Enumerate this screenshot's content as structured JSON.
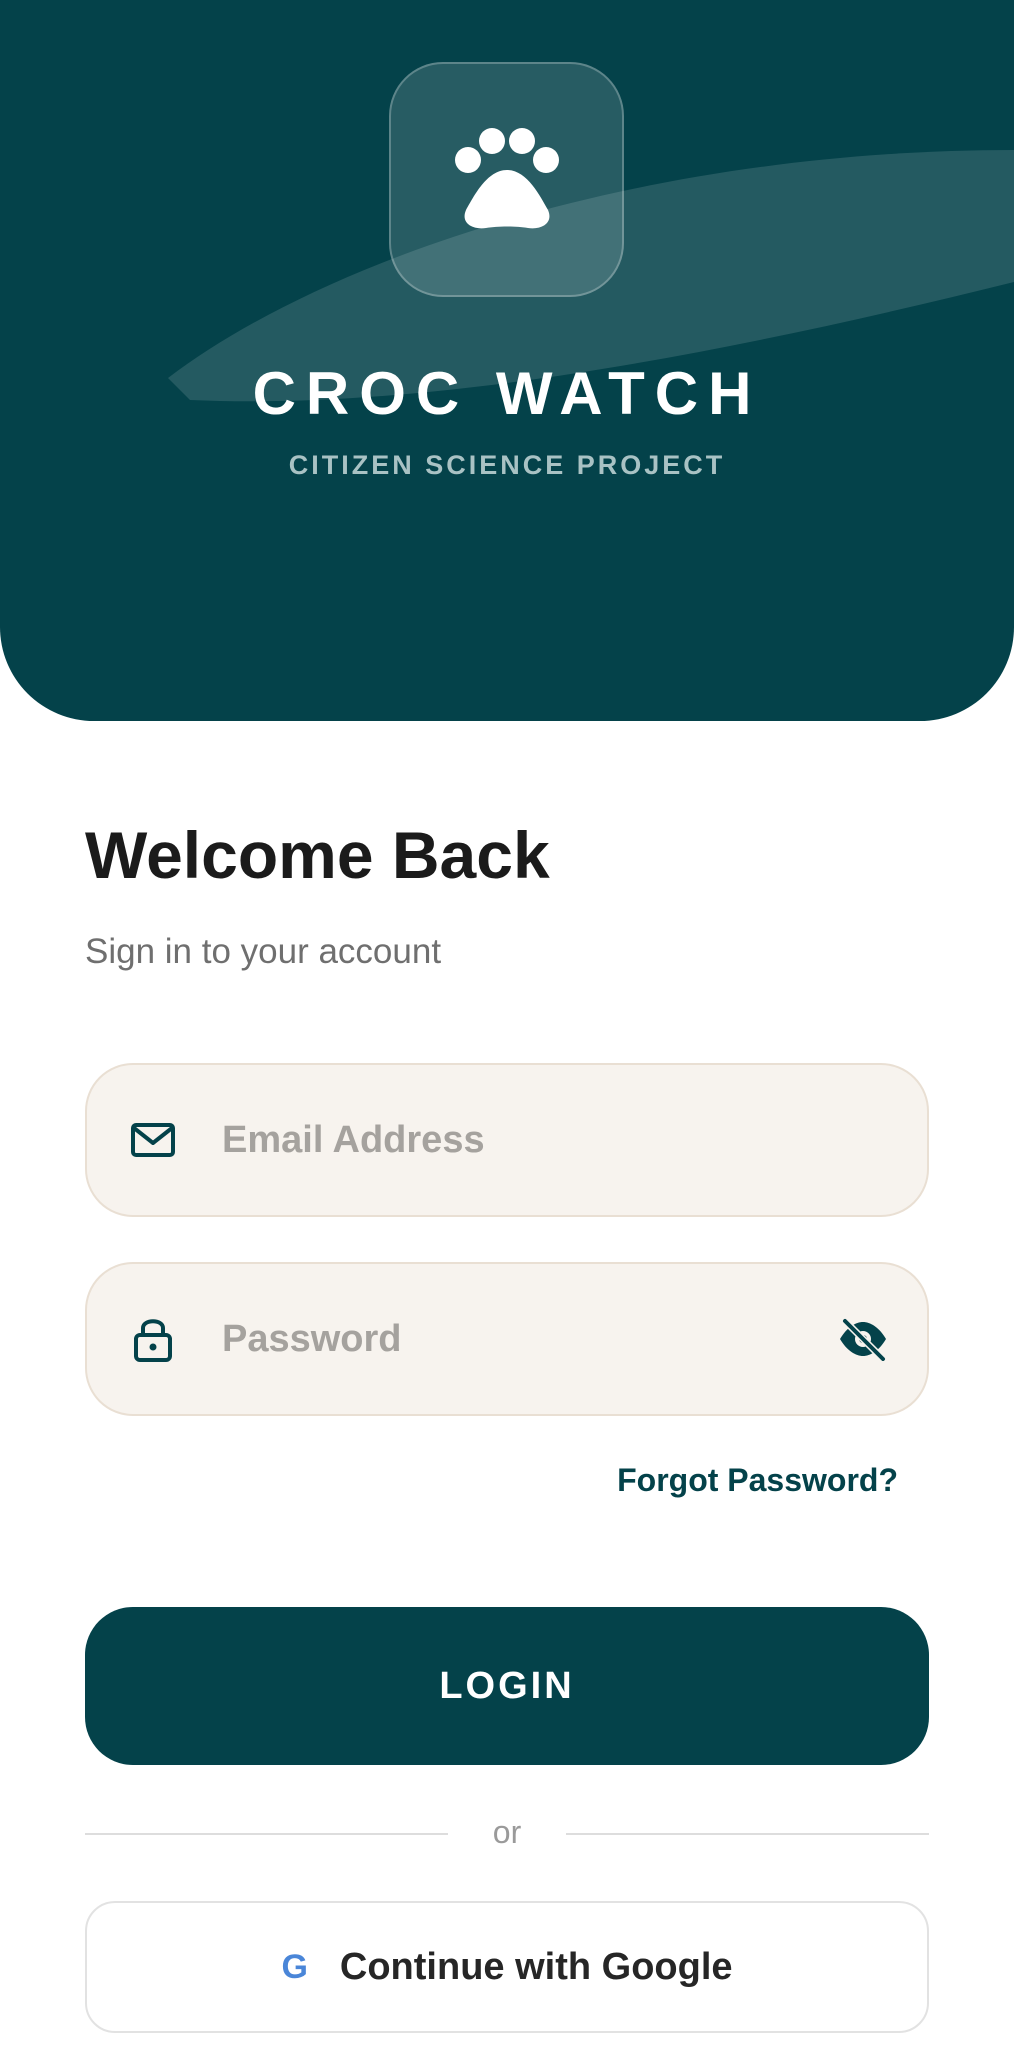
{
  "header": {
    "app_title": "CROC WATCH",
    "app_subtitle": "CITIZEN SCIENCE PROJECT",
    "logo_icon": "paw-icon",
    "background_color": "#04424a"
  },
  "welcome": {
    "title": "Welcome Back",
    "subtitle": "Sign in to your account"
  },
  "form": {
    "email": {
      "placeholder": "Email Address",
      "value": "",
      "icon": "mail-icon"
    },
    "password": {
      "placeholder": "Password",
      "value": "",
      "icon": "lock-icon",
      "toggle_icon": "eye-off-icon"
    },
    "forgot_password_label": "Forgot Password?",
    "login_label": "LOGIN"
  },
  "divider": {
    "text": "or"
  },
  "google": {
    "icon_text": "G",
    "label": "Continue with Google"
  },
  "colors": {
    "primary": "#04424a",
    "field_background": "#f7f3ee",
    "field_border": "#e9dfd3",
    "google_blue": "#4a86d8"
  }
}
